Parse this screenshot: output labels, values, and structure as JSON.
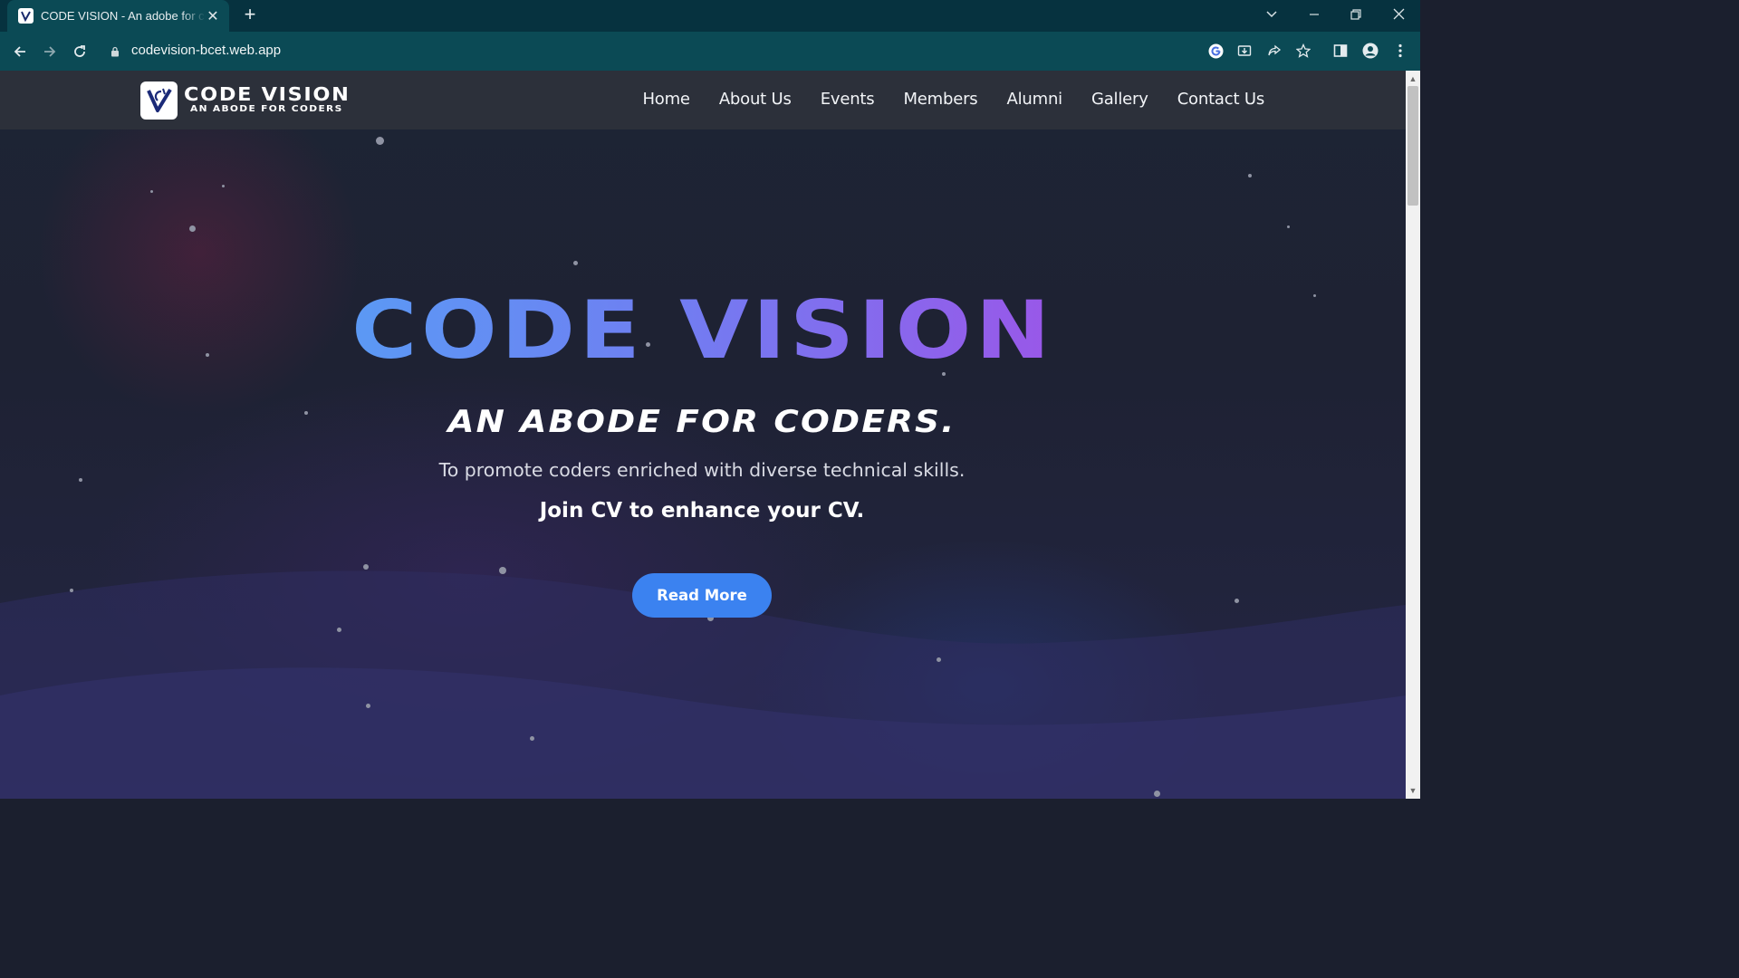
{
  "browser": {
    "tab_title": "CODE VISION - An adobe for coders",
    "tab_close_icon": "close-icon",
    "new_tab_label": "+",
    "url": "codevision-bcet.web.app"
  },
  "site": {
    "logo_title": "CODE VISION",
    "logo_subtitle": "AN ABODE FOR CODERS",
    "nav": [
      {
        "label": "Home"
      },
      {
        "label": "About Us"
      },
      {
        "label": "Events"
      },
      {
        "label": "Members"
      },
      {
        "label": "Alumni"
      },
      {
        "label": "Gallery"
      },
      {
        "label": "Contact Us"
      }
    ]
  },
  "hero": {
    "title": "CODE VISION",
    "subtitle": "AN ABODE FOR CODERS.",
    "description": "To promote coders enriched with diverse technical skills.",
    "tagline": "Join CV to enhance your CV.",
    "button_label": "Read More"
  },
  "colors": {
    "accent": "#3b82f0",
    "title_gradient_start": "#55a1f5",
    "title_gradient_end": "#a34ee6",
    "navbar": "#2c303a",
    "browser_tabbar": "#06323f",
    "browser_toolbar": "#0b4a55"
  }
}
